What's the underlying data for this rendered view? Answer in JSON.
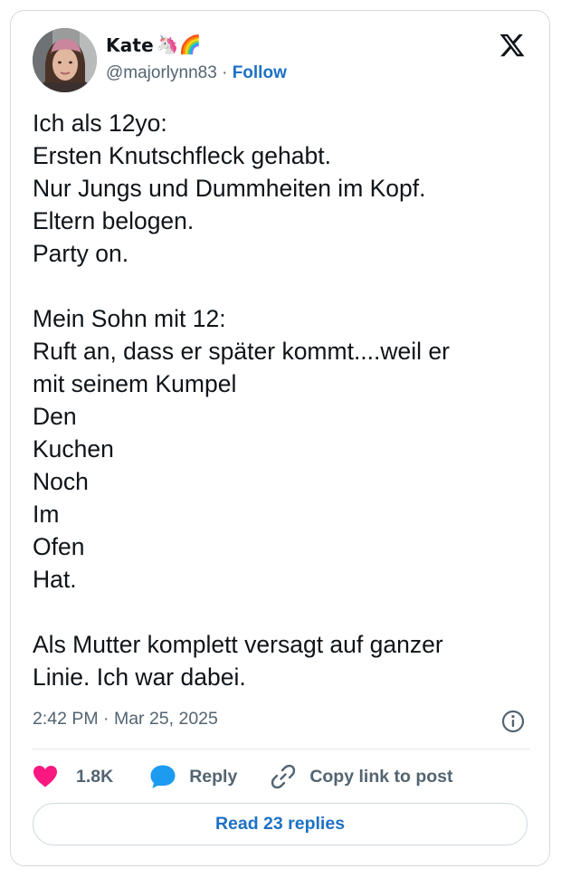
{
  "author": {
    "display_name": "Kate",
    "name_emojis": "🦄🌈",
    "handle": "@majorlynn83",
    "separator": " · ",
    "follow_label": "Follow"
  },
  "tweet": {
    "text": "Ich als 12yo:\nErsten Knutschfleck gehabt.\nNur Jungs und Dummheiten im Kopf.\nEltern belogen.\nParty on.\n\nMein Sohn mit 12:\nRuft an, dass er später kommt....weil er\nmit seinem Kumpel\nDen\nKuchen\nNoch\nIm\nOfen\nHat.\n\nAls Mutter komplett versagt auf ganzer\nLinie. Ich war dabei.",
    "timestamp": "2:42 PM · Mar 25, 2025"
  },
  "actions": {
    "like_count": "1.8K",
    "reply_label": "Reply",
    "copy_link_label": "Copy link to post"
  },
  "read_replies_label": "Read 23 replies",
  "icons": {
    "logo": "x-logo-icon",
    "info": "info-icon",
    "like": "heart-icon",
    "reply": "speech-bubble-icon",
    "copy_link": "link-icon"
  },
  "colors": {
    "link": "#1d71c4",
    "like": "#f91880",
    "reply": "#1d9bf0",
    "muted": "#536471",
    "text": "#0f1419"
  }
}
